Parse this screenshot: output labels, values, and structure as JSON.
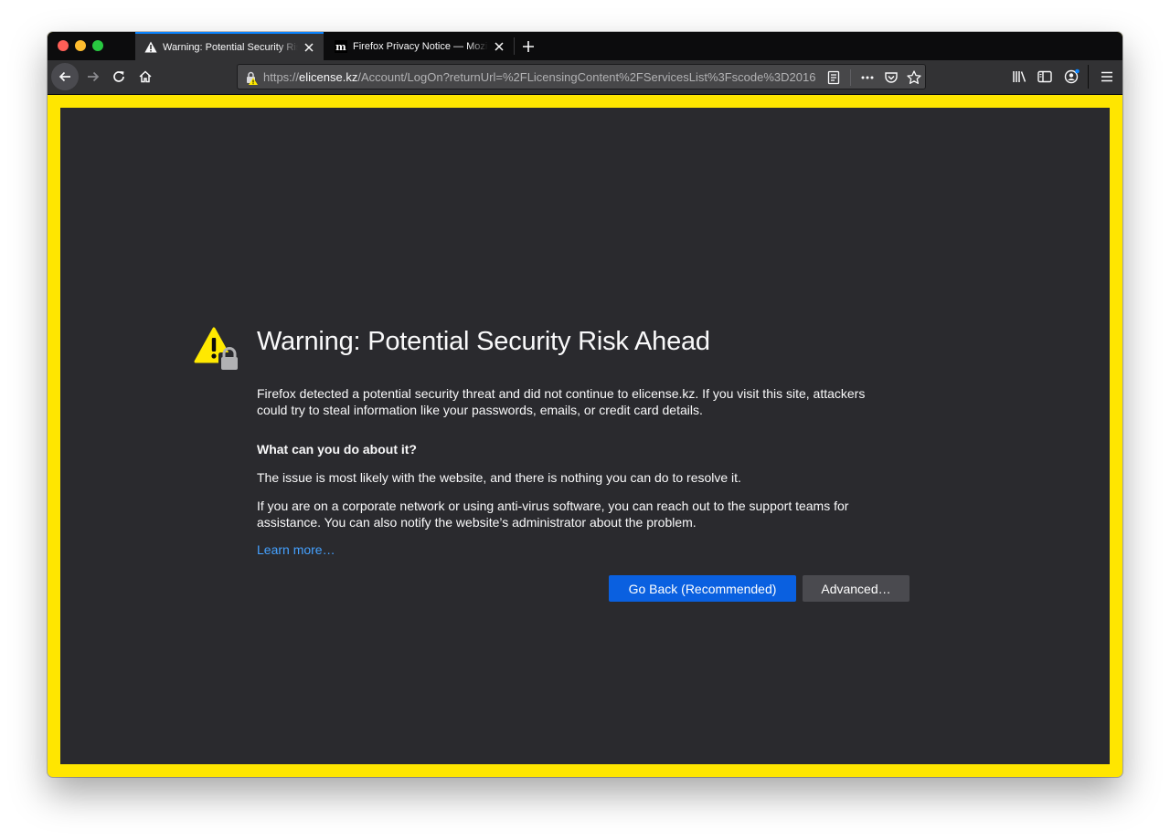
{
  "tabs": [
    {
      "title": "Warning: Potential Security Risk Ahead",
      "icon": "warning-icon",
      "active": true
    },
    {
      "title": "Firefox Privacy Notice — Mozilla",
      "icon": "mozilla-m-icon",
      "active": false
    }
  ],
  "new_tab_label": "+",
  "url": {
    "scheme": "https://",
    "host": "elicense.kz",
    "path": "/Account/LogOn?returnUrl=%2FLicensingContent%2FServicesList%3Fscode%3D2016"
  },
  "error_page": {
    "title": "Warning: Potential Security Risk Ahead",
    "intro": "Firefox detected a potential security threat and did not continue to elicense.kz. If you visit this site, attackers could try to steal information like your passwords, emails, or credit card details.",
    "subheading": "What can you do about it?",
    "para_issue": "The issue is most likely with the website, and there is nothing you can do to resolve it.",
    "para_network": "If you are on a corporate network or using anti-virus software, you can reach out to the support teams for assistance. You can also notify the website’s administrator about the problem.",
    "learn_more": "Learn more…",
    "go_back_button": "Go Back (Recommended)",
    "advanced_button": "Advanced…"
  },
  "colors": {
    "frame_highlight": "#ffe600",
    "page_background": "#2a2a2e",
    "primary_button": "#0a60e0",
    "link": "#45a1ff",
    "warning_yellow": "#ffe900"
  }
}
